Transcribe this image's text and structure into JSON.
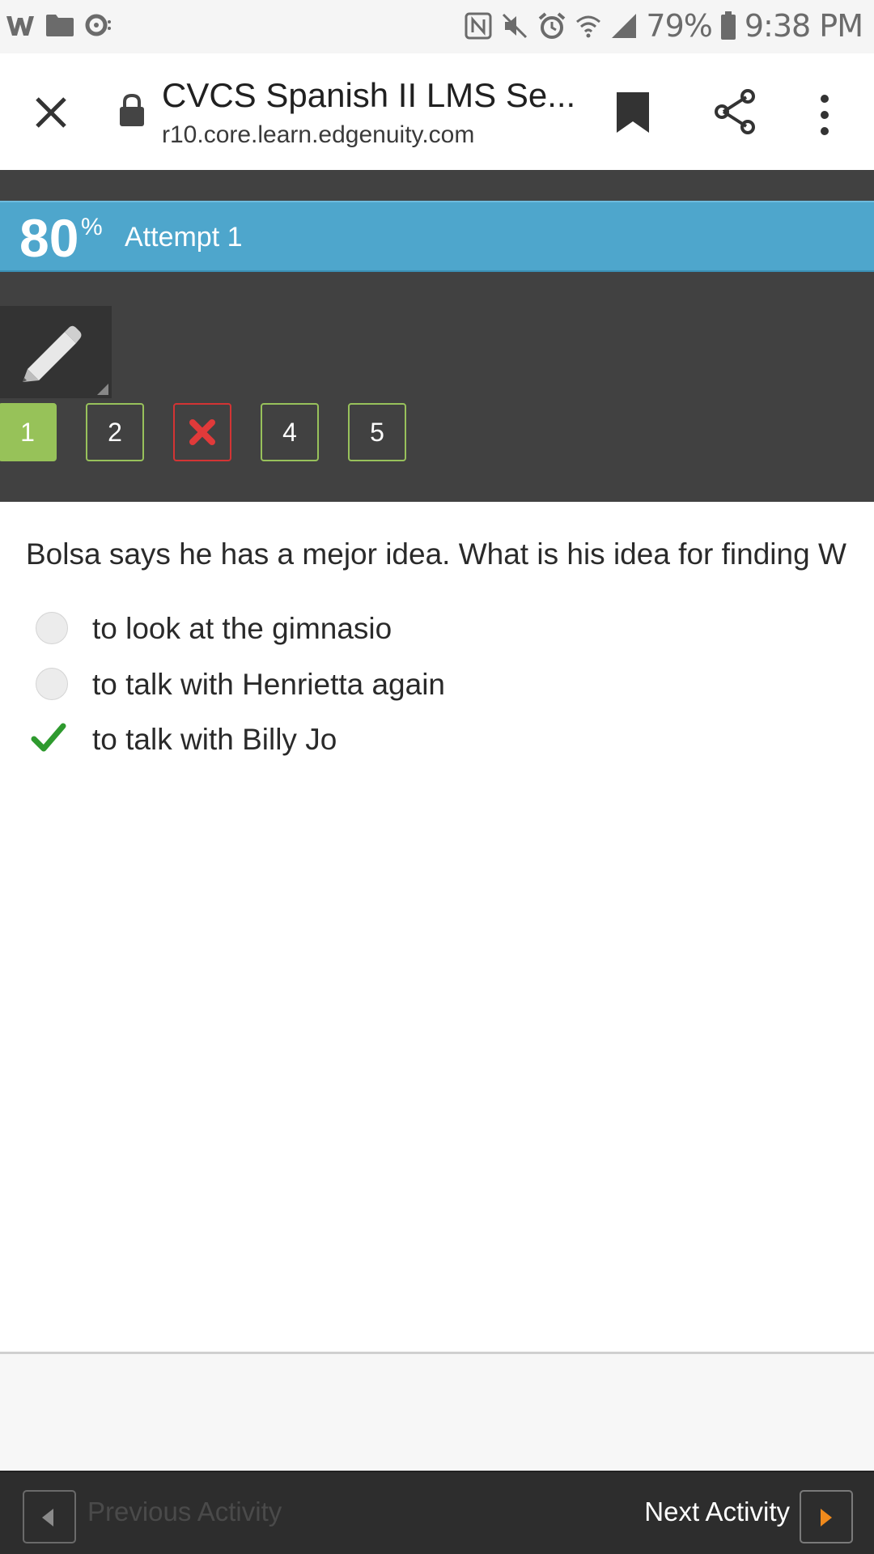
{
  "status_bar": {
    "battery": "79%",
    "time": "9:38 PM",
    "icons_left": [
      "w-app-icon",
      "folder-icon",
      "sync-icon"
    ],
    "icons_right": [
      "nfc-icon",
      "mute-icon",
      "alarm-icon",
      "wifi-icon",
      "signal-icon",
      "battery-icon"
    ]
  },
  "browser": {
    "title": "CVCS Spanish II LMS Se...",
    "url": "r10.core.learn.edgenuity.com"
  },
  "score": {
    "value": "80",
    "percent_sign": "%",
    "attempt": "Attempt 1",
    "bar_color": "#4ea6cc"
  },
  "question_nav": {
    "items": [
      {
        "label": "1",
        "state": "current"
      },
      {
        "label": "2",
        "state": "answered"
      },
      {
        "label": "",
        "state": "incorrect"
      },
      {
        "label": "4",
        "state": "answered"
      },
      {
        "label": "5",
        "state": "answered"
      }
    ]
  },
  "question": {
    "text": "Bolsa says he has a mejor idea. What is his idea for finding W",
    "options": [
      {
        "label": "to look at the gimnasio",
        "state": "unselected"
      },
      {
        "label": "to talk with Henrietta again",
        "state": "unselected"
      },
      {
        "label": "to talk with Billy Jo",
        "state": "correct"
      }
    ]
  },
  "footer": {
    "prev_label": "Previous Activity",
    "next_label": "Next Activity",
    "accent": "#f08a1c"
  }
}
